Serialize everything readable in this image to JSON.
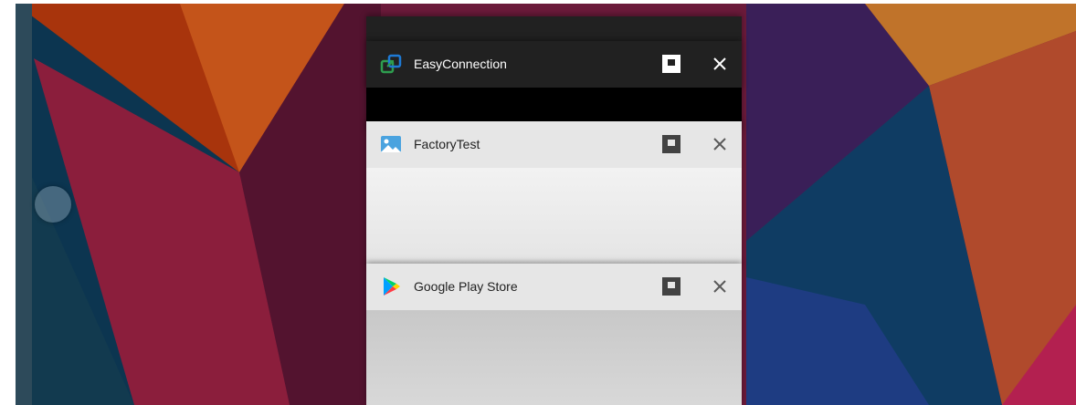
{
  "recents": {
    "cards": [
      {
        "title": "EasyConnection",
        "icon": "easyconnection-icon",
        "theme": "dark"
      },
      {
        "title": "FactoryTest",
        "icon": "gallery-image-icon",
        "theme": "light"
      },
      {
        "title": "Google Play Store",
        "icon": "google-play-icon",
        "theme": "light"
      }
    ],
    "buttons": {
      "multiwindow_icon": "square-window-icon",
      "close_icon": "close-x-icon"
    }
  },
  "colors": {
    "dark_header": "#212121",
    "light_header": "#e6e6e6",
    "easyconnection_green": "#2e9e4f",
    "easyconnection_blue": "#1e7ad6"
  }
}
